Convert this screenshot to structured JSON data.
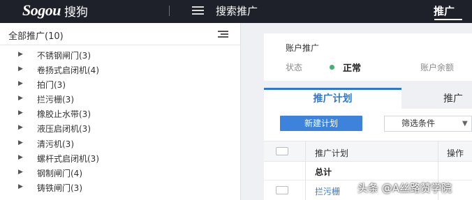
{
  "topbar": {
    "logo_word": "Sogou",
    "logo_cn": "搜狗",
    "title": "搜索推广",
    "right_tab": "推广"
  },
  "sidebar": {
    "title": "全部推广(10)",
    "items": [
      {
        "label": "不锈钢闸门(3)"
      },
      {
        "label": "卷扬式启闭机(4)"
      },
      {
        "label": "拍门(3)"
      },
      {
        "label": "拦污栅(3)"
      },
      {
        "label": "橡胶止水带(3)"
      },
      {
        "label": "液压启闭机(3)"
      },
      {
        "label": "清污机(3)"
      },
      {
        "label": "螺杆式启闭机(3)"
      },
      {
        "label": "钢制闸门(4)"
      },
      {
        "label": "铸铁闸门(3)"
      }
    ]
  },
  "account": {
    "title": "账户推广",
    "status_label": "状态",
    "status_value": "正常",
    "balance_label": "账户余额"
  },
  "tabs": {
    "active": "推广计划",
    "inactive": "推广"
  },
  "toolbar": {
    "new_plan": "新建计划",
    "filter": "筛选条件"
  },
  "table": {
    "headers": [
      "推广计划",
      "操作"
    ],
    "total_label": "总计",
    "rows": [
      {
        "name": "拦污栅"
      }
    ]
  },
  "watermark": "头条 @A丝路赞学院",
  "colors": {
    "topbar": "#1e2129",
    "accent": "#2d78d6",
    "status_ok": "#3cb371"
  }
}
